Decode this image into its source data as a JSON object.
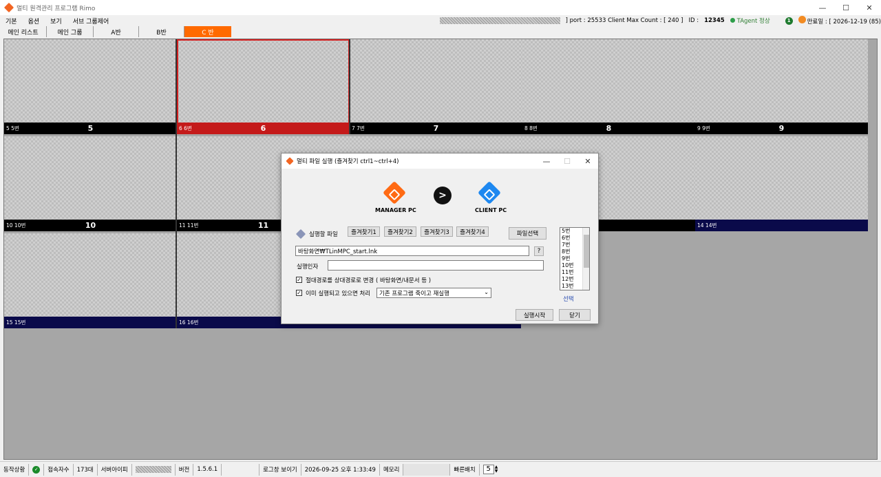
{
  "window": {
    "title": "멀티 원격관리 프로그램 Rimo",
    "minimize": "—",
    "maximize": "☐",
    "close": "✕"
  },
  "menu": [
    "기본",
    "옵션",
    "보기",
    "서브 그룹제어"
  ],
  "status_top": {
    "port_text": "] port : 25533 Client Max Count : [ 240 ]",
    "id_label": "ID :",
    "id_value": "12345",
    "agent_status": "TAgent 정상",
    "notice_count": "1",
    "expiry": "만료일 : [ 2026-12-19 (85)"
  },
  "tabs": [
    "메인 리스트",
    "메인 그룹",
    "A반",
    "B반",
    "C 반"
  ],
  "tiles": [
    {
      "label": "5 5번",
      "num": "5"
    },
    {
      "label": "6 6번",
      "num": "6"
    },
    {
      "label": "7 7번",
      "num": "7"
    },
    {
      "label": "8 8번",
      "num": "8"
    },
    {
      "label": "9 9번",
      "num": "9"
    },
    {
      "label": "10 10번",
      "num": "10"
    },
    {
      "label": "11 11번",
      "num": "11"
    },
    {
      "label": "14 14번",
      "num": ""
    },
    {
      "label": "15 15번",
      "num": ""
    },
    {
      "label": "16 16번",
      "num": ""
    }
  ],
  "dialog": {
    "title": "멀티 파일 실행 (즐겨찾기 ctrl1~ctrl+4)",
    "manager_label": "MANAGER PC",
    "client_label": "CLIENT PC",
    "arrow": ">",
    "exec_file_label": "실행할 파일",
    "fav1": "즐겨찾기1",
    "fav2": "즐겨찾기2",
    "fav3": "즐겨찾기3",
    "fav4": "즐겨찾기4",
    "file_select": "파일선택",
    "file_path": "바탕화면₩TLinMPC_start.lnk",
    "help": "?",
    "args_label": "실행인자",
    "args_value": "",
    "chk_relative": "절대경로를 상대경로로 변경 ( 바탕화면/내문서 등 )",
    "chk_running": "이미 실행되고 있으면 처리",
    "running_option": "기존 프로그램 죽이고 재실행",
    "list": [
      "5번",
      "6번",
      "7번",
      "8번",
      "9번",
      "10번",
      "11번",
      "12번",
      "13번"
    ],
    "select_link": "선택",
    "start_button": "실행시작",
    "close_button": "닫기"
  },
  "statusbar": {
    "state_label": "동작상황",
    "conn_label": "접속자수",
    "conn_value": "173대",
    "server_ip_label": "서버아이피",
    "version_label": "버전",
    "version_value": "1.5.6.1",
    "log_label": "로그창 보이기",
    "datetime": "2026-09-25 오후 1:33:49",
    "memory_label": "메모리",
    "fast_layout_label": "빠른배치",
    "fast_layout_value": "5"
  }
}
